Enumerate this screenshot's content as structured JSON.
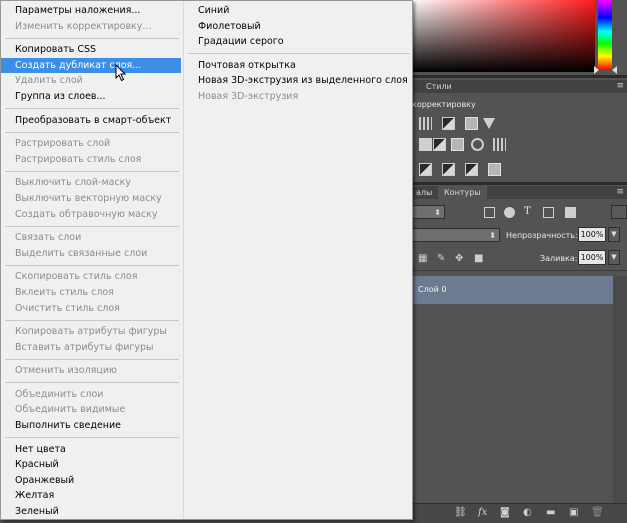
{
  "menu": {
    "groups": [
      [
        {
          "label": "Параметры наложения...",
          "enabled": true
        },
        {
          "label": "Изменить корректировку...",
          "enabled": false
        }
      ],
      [
        {
          "label": "Копировать CSS",
          "enabled": true
        },
        {
          "label": "Создать дубликат слоя...",
          "enabled": true,
          "highlighted": true
        },
        {
          "label": "Удалить слой",
          "enabled": false
        },
        {
          "label": "Группа из слоев...",
          "enabled": true
        }
      ],
      [
        {
          "label": "Преобразовать в смарт-объект",
          "enabled": true
        }
      ],
      [
        {
          "label": "Растрировать слой",
          "enabled": false
        },
        {
          "label": "Растрировать стиль слоя",
          "enabled": false
        }
      ],
      [
        {
          "label": "Выключить слой-маску",
          "enabled": false
        },
        {
          "label": "Выключить векторную маску",
          "enabled": false
        },
        {
          "label": "Создать обтравочную маску",
          "enabled": false
        }
      ],
      [
        {
          "label": "Связать слои",
          "enabled": false
        },
        {
          "label": "Выделить связанные слои",
          "enabled": false
        }
      ],
      [
        {
          "label": "Скопировать стиль слоя",
          "enabled": false
        },
        {
          "label": "Вклеить стиль слоя",
          "enabled": false
        },
        {
          "label": "Очистить стиль слоя",
          "enabled": false
        }
      ],
      [
        {
          "label": "Копировать атрибуты фигуры",
          "enabled": false
        },
        {
          "label": "Вставить атрибуты фигуры",
          "enabled": false
        }
      ],
      [
        {
          "label": "Отменить изоляцию",
          "enabled": false
        }
      ],
      [
        {
          "label": "Объединить слои",
          "enabled": false
        },
        {
          "label": "Объединить видимые",
          "enabled": false
        },
        {
          "label": "Выполнить сведение",
          "enabled": true
        }
      ],
      [
        {
          "label": "Нет цвета",
          "enabled": true
        },
        {
          "label": "Красный",
          "enabled": true
        },
        {
          "label": "Оранжевый",
          "enabled": true
        },
        {
          "label": "Желтая",
          "enabled": true
        },
        {
          "label": "Зеленый",
          "enabled": true
        }
      ]
    ],
    "groups_col2": [
      [
        {
          "label": "Синий",
          "enabled": true
        },
        {
          "label": "Фиолетовый",
          "enabled": true
        },
        {
          "label": "Градации серого",
          "enabled": true
        }
      ],
      [
        {
          "label": "Почтовая открытка",
          "enabled": true
        },
        {
          "label": "Новая 3D-экструзия из выделенного слоя",
          "enabled": true
        },
        {
          "label": "Новая 3D-экструзия",
          "enabled": false
        }
      ]
    ]
  },
  "panels": {
    "styles_tab": "Стили",
    "adjustments_hint": "корректировку",
    "channels_tab": "алы",
    "paths_tab": "Контуры",
    "opacity_label": "Непрозрачность:",
    "opacity_value": "100%",
    "fill_label": "Заливка:",
    "fill_value": "100%",
    "layer_name": "Слой 0",
    "panel_menu_icon": "≡"
  },
  "colors": {
    "menu_bg": "#f0f0f0",
    "highlight": "#3c8ee6",
    "disabled_text": "#8c8c8c",
    "panel_bg": "#535353",
    "selected_layer": "#6d7b90"
  }
}
